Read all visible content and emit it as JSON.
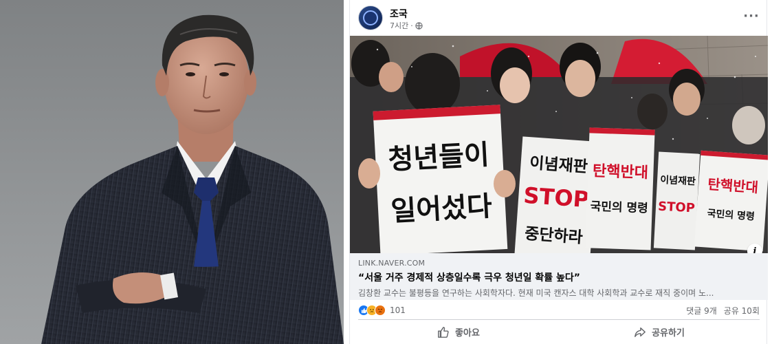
{
  "post": {
    "author": "조국",
    "time": "7시간",
    "separator": "·",
    "link": {
      "domain": "LINK.NAVER.COM",
      "title": "“서울 거주 경제적 상층일수록 극우 청년일 확률 높다”",
      "description": "김창환 교수는 불평등을 연구하는 사회학자다. 현재 미국 캔자스 대학 사회학과 교수로 재직 중이며 노..."
    },
    "image_signs": {
      "sign1_line1": "청년들이",
      "sign1_line2": "일어섰다",
      "sign2_line1": "이념재판",
      "sign2_line2": "STOP",
      "sign2_line3": "중단하라",
      "sign3_line1": "탄핵반대",
      "sign3_line2": "국민의 명령",
      "sign4_line1": "이념재판",
      "sign4_line2": "STOP",
      "sign5_line1": "탄핵반대",
      "sign5_line2": "국민의 명령"
    },
    "info_label": "i",
    "stats": {
      "reaction_count": "101",
      "comments": "댓글 9개",
      "shares": "공유 10회"
    },
    "actions": {
      "like": "좋아요",
      "share": "공유하기"
    },
    "more_label": "···"
  },
  "colors": {
    "like_blue": "#1877f2",
    "secondary_text": "#65676b",
    "preview_bg": "#f0f2f5",
    "sign_red": "#d0102a"
  },
  "icons": {
    "globe": "globe-icon",
    "like": "thumbs-up-icon",
    "share": "share-arrow-icon",
    "more": "more-options-icon",
    "info": "info-icon"
  }
}
